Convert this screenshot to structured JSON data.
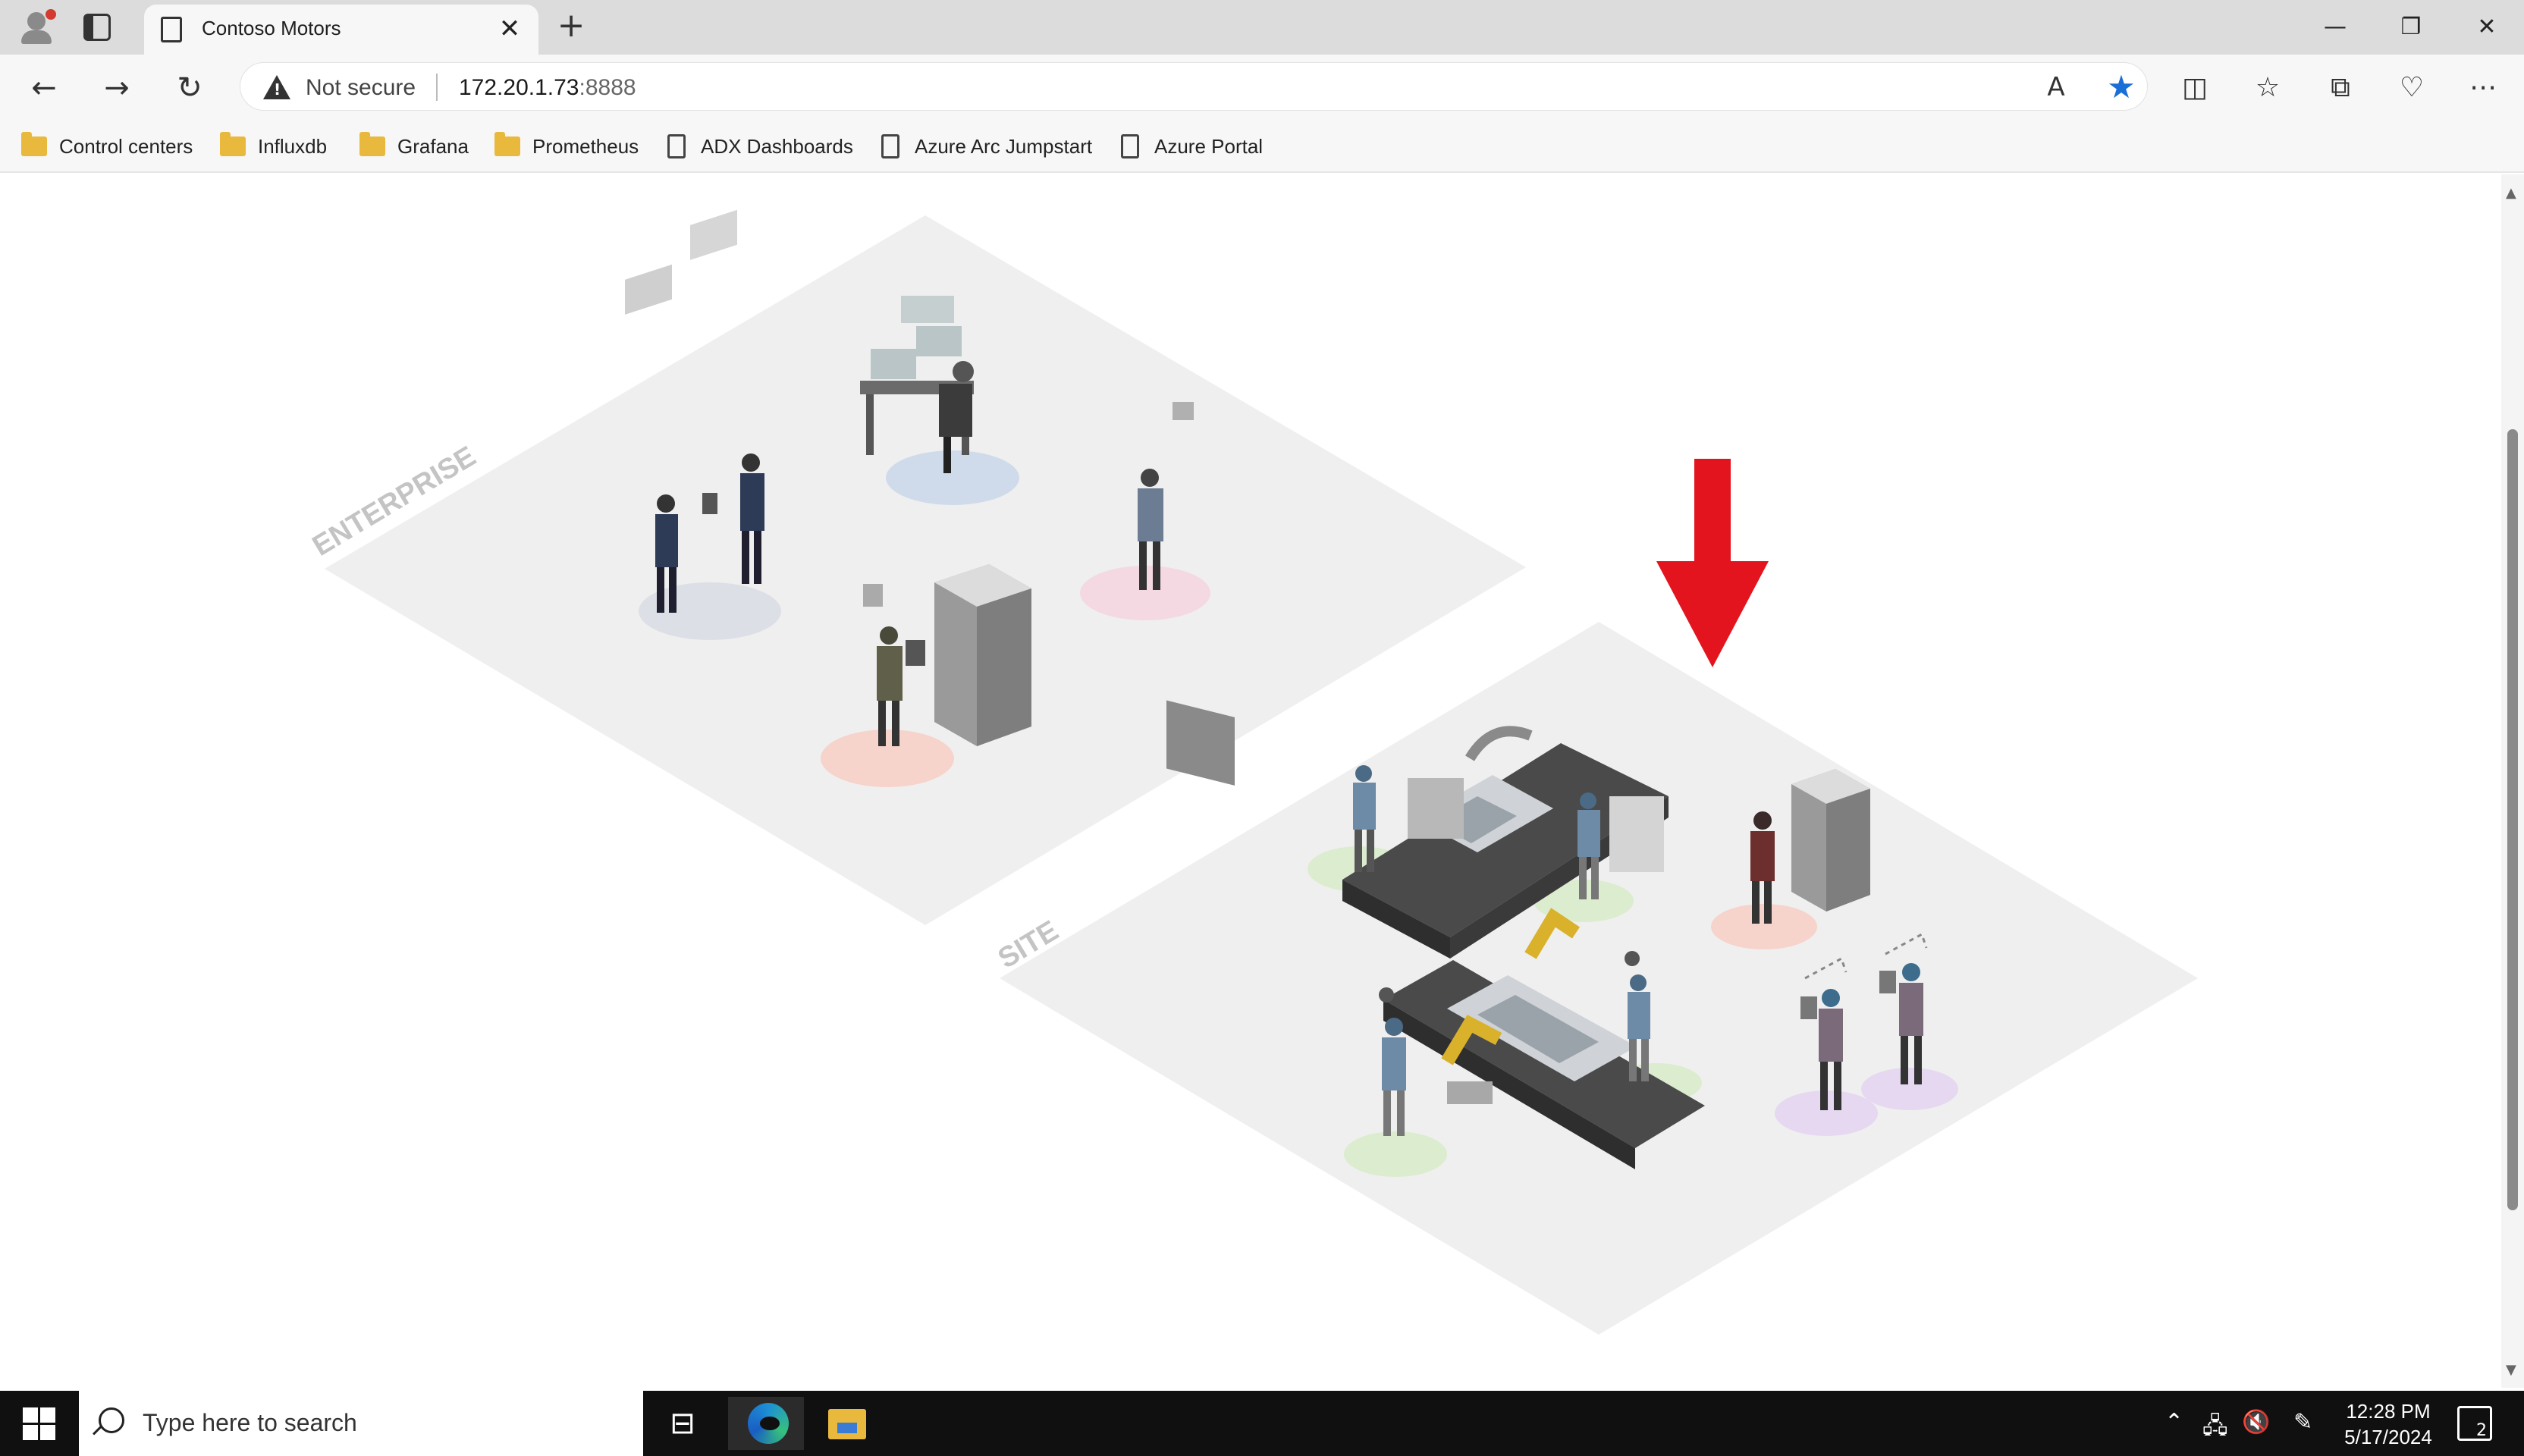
{
  "browser": {
    "tab_title": "Contoso Motors",
    "new_tab_symbol": "+",
    "close_tab_symbol": "✕",
    "window_controls": {
      "minimize": "—",
      "restore": "❐",
      "close": "✕"
    },
    "address": {
      "security_label": "Not secure",
      "url_host": "172.20.1.73",
      "url_port": ":8888"
    },
    "accent_color": "#1a6ed8"
  },
  "bookmarks": [
    {
      "label": "Control centers",
      "icon": "folder-icon"
    },
    {
      "label": "Influxdb",
      "icon": "folder-icon"
    },
    {
      "label": "Grafana",
      "icon": "folder-icon"
    },
    {
      "label": "Prometheus",
      "icon": "folder-icon"
    },
    {
      "label": "ADX Dashboards",
      "icon": "page-icon"
    },
    {
      "label": "Azure Arc Jumpstart",
      "icon": "page-icon"
    },
    {
      "label": "Azure Portal",
      "icon": "page-icon"
    }
  ],
  "scene": {
    "enterprise_label": "ENTERPRISE",
    "site_label": "SITE",
    "arrow_color": "#e3141e"
  },
  "taskbar": {
    "search_placeholder": "Type here to search",
    "time": "12:28 PM",
    "date": "5/17/2024",
    "notification_count": "2"
  }
}
